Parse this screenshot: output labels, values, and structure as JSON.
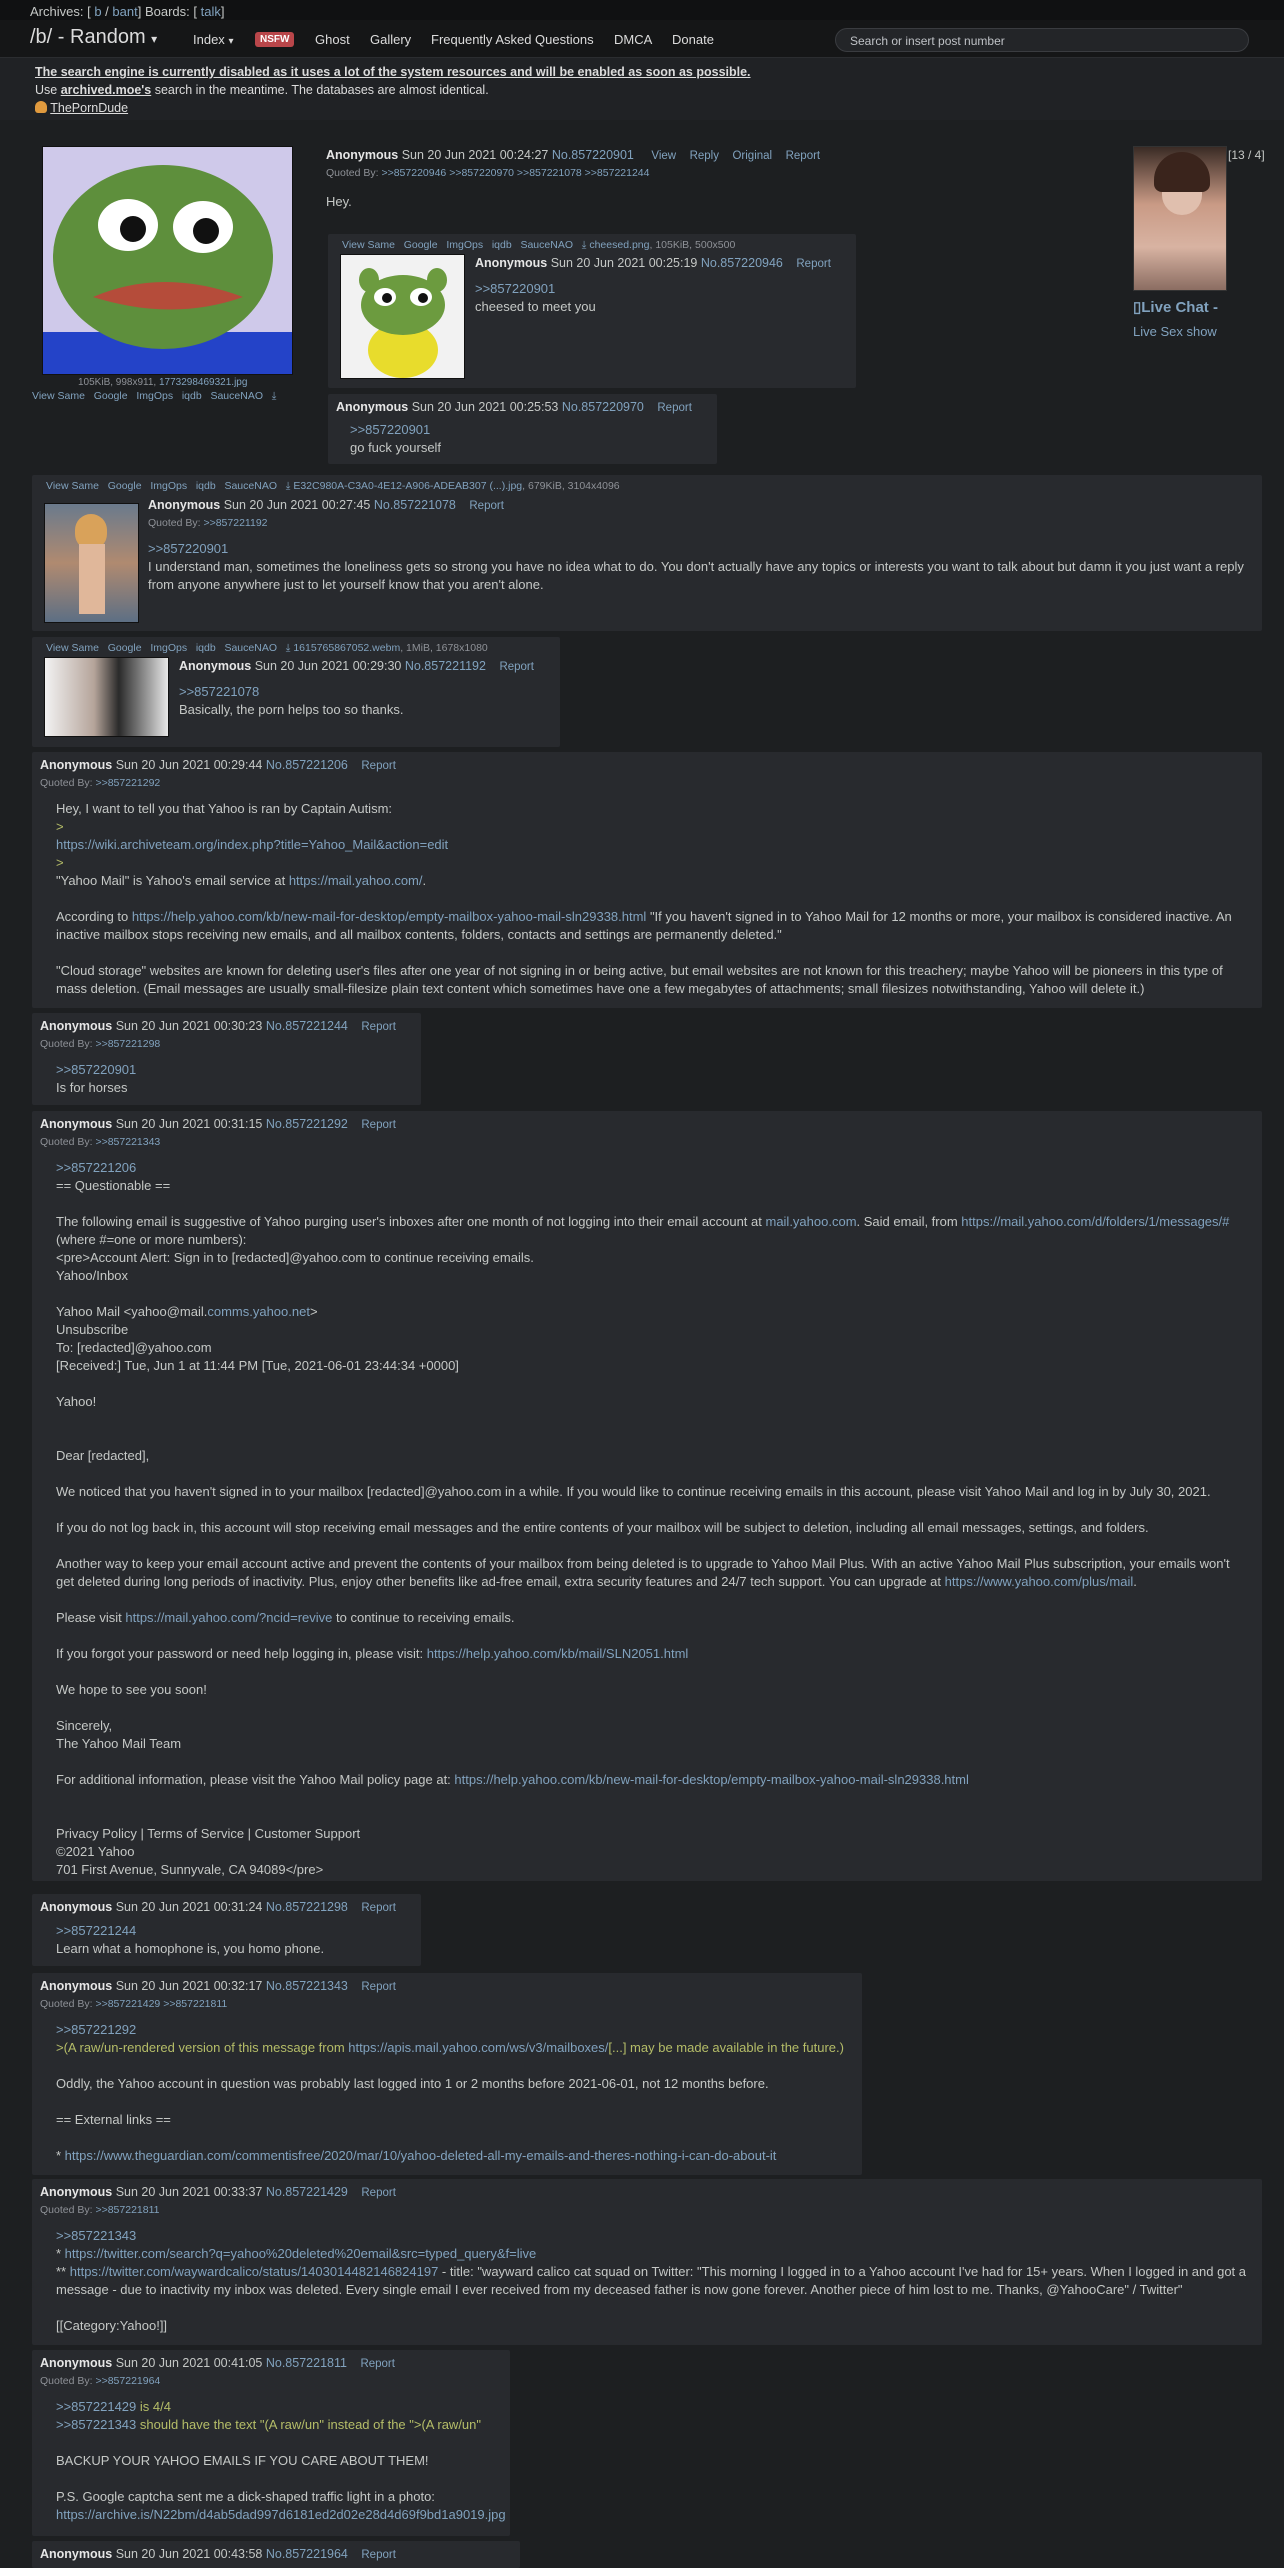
{
  "topbar": {
    "archives_label": "Archives: [",
    "archive_link_1": "b",
    "sep": "/",
    "archive_link_2": "bant",
    "boards_label": "] Boards: [",
    "board_link": "talk",
    "close": "]"
  },
  "nav": {
    "board_title": "/b/ - Random",
    "board_caret": "▾",
    "index_label": "Index",
    "index_caret": "▾",
    "nsfw_badge": "NSFW",
    "ghost": "Ghost",
    "gallery": "Gallery",
    "faq": "Frequently Asked Questions",
    "dmca": "DMCA",
    "donate": "Donate",
    "search_placeholder": "Search or insert post number"
  },
  "notice": {
    "line1": "The search engine is currently disabled as it uses a lot of the system resources and will be enabled as soon as possible.",
    "line2_pre": "Use ",
    "line2_link": "archived.moe's",
    "line2_post": " search in the meantime. The databases are almost identical.",
    "sponsor": "ThePornDude"
  },
  "ad": {
    "counter": "[13 / 4]",
    "title": "Live Chat -",
    "subtitle": "Live Sex show"
  },
  "op": {
    "file_info": "105KiB, 998x911, ",
    "file_name": "1773298469321.jpg",
    "tools": [
      "View Same",
      "Google",
      "ImgOps",
      "iqdb",
      "SauceNAO"
    ],
    "name": "Anonymous",
    "time": "Sun 20 Jun 2021 00:24:27",
    "num": "No.857220901",
    "ctl_view": "View",
    "ctl_reply": "Reply",
    "ctl_original": "Original",
    "ctl_report": "Report",
    "quoted_by_label": "Quoted By:",
    "quoted_by": ">>857220946 >>857220970 >>857221078 >>857221244",
    "text": "Hey."
  },
  "r1": {
    "tools": [
      "View Same",
      "Google",
      "ImgOps",
      "iqdb",
      "SauceNAO"
    ],
    "file_name": "cheesed.png",
    "file_info": ", 105KiB, 500x500",
    "name": "Anonymous",
    "time": "Sun 20 Jun 2021 00:25:19",
    "num": "No.857220946",
    "report": "Report",
    "quote": ">>857220901",
    "text": "cheesed to meet you"
  },
  "r2": {
    "name": "Anonymous",
    "time": "Sun 20 Jun 2021 00:25:53",
    "num": "No.857220970",
    "report": "Report",
    "quote": ">>857220901",
    "text": "go fuck yourself"
  },
  "r3": {
    "tools": [
      "View Same",
      "Google",
      "ImgOps",
      "iqdb",
      "SauceNAO"
    ],
    "file_name": "E32C980A-C3A0-4E12-A906-ADEAB307 (...).jpg",
    "file_info": ", 679KiB, 3104x4096",
    "name": "Anonymous",
    "time": "Sun 20 Jun 2021 00:27:45",
    "num": "No.857221078",
    "report": "Report",
    "quoted_by_label": "Quoted By:",
    "quoted_by": ">>857221192",
    "quote": ">>857220901",
    "text": "I understand man, sometimes the loneliness gets so strong you have no idea what to do. You don't actually have any topics or interests you want to talk about but damn it you just want a reply from anyone anywhere just to let yourself know that you aren't alone."
  },
  "r4": {
    "tools": [
      "View Same",
      "Google",
      "ImgOps",
      "iqdb",
      "SauceNAO"
    ],
    "file_name": "1615765867052.webm",
    "file_info": ", 1MiB, 1678x1080",
    "name": "Anonymous",
    "time": "Sun 20 Jun 2021 00:29:30",
    "num": "No.857221192",
    "report": "Report",
    "quote": ">>857221078",
    "text": "Basically, the porn helps too so thanks."
  },
  "r5": {
    "name": "Anonymous",
    "time": "Sun 20 Jun 2021 00:29:44",
    "num": "No.857221206",
    "report": "Report",
    "quoted_by_label": "Quoted By:",
    "quoted_by": ">>857221292",
    "l1": "Hey, I want to tell you that Yahoo is ran by Captain Autism:",
    "l2": ">",
    "l3": "https://wiki.archiveteam.org/index.php?title=Yahoo_Mail&action=edit",
    "l4": ">",
    "l5_pre": "\"Yahoo Mail\" is Yahoo's email service at ",
    "l5_link": "https://mail.yahoo.com/",
    "l5_post": ".",
    "l6_pre": "According to ",
    "l6_link": "https://help.yahoo.com/kb/new-mail-for-desktop/empty-mailbox-yahoo-mail-sln29338.html",
    "l6_post": " \"If you haven't signed in to Yahoo Mail for 12 months or more, your mailbox is considered inactive. An inactive mailbox stops receiving new emails, and all mailbox contents, folders, contacts and settings are permanently deleted.\"",
    "l7": "\"Cloud storage\" websites are known for deleting user's files after one year of not signing in or being active, but email websites are not known for this treachery; maybe Yahoo will be pioneers in this type of mass deletion. (Email messages are usually small-filesize plain text content which sometimes have one a few megabytes of attachments; small filesizes notwithstanding, Yahoo will delete it.)"
  },
  "r6": {
    "name": "Anonymous",
    "time": "Sun 20 Jun 2021 00:30:23",
    "num": "No.857221244",
    "report": "Report",
    "quoted_by_label": "Quoted By:",
    "quoted_by": ">>857221298",
    "quote": ">>857220901",
    "text": "Is for horses"
  },
  "r7": {
    "name": "Anonymous",
    "time": "Sun 20 Jun 2021 00:31:15",
    "num": "No.857221292",
    "report": "Report",
    "quoted_by_label": "Quoted By:",
    "quoted_by": ">>857221343",
    "quote": ">>857221206",
    "l1": "== Questionable ==",
    "l2_pre": "The following email is suggestive of Yahoo purging user's inboxes after one month of not logging into their email account at ",
    "l2_link1": "mail.yahoo.com",
    "l2_mid": ". Said email, from ",
    "l2_link2": "https://mail.yahoo.com/d/folders/1/messages/#",
    "l3": "(where #=one or more numbers):",
    "l4": "<pre>Account Alert: Sign in to [redacted]@yahoo.com to continue receiving emails.",
    "l5": "Yahoo/Inbox",
    "l6_pre": "Yahoo Mail <yahoo@mail.",
    "l6_link": "comms.yahoo.net",
    "l6_post": ">",
    "l7": "Unsubscribe",
    "l8": "To: [redacted]@yahoo.com",
    "l9": "[Received:] Tue, Jun 1 at 11:44 PM [Tue, 2021-06-01 23:44:34 +0000]",
    "l10": "Yahoo!",
    "l11": "Dear [redacted],",
    "l12": "We noticed that you haven't signed in to your mailbox [redacted]@yahoo.com in a while. If you would like to continue receiving emails in this account, please visit Yahoo Mail and log in by July 30, 2021.",
    "l13": "If you do not log back in, this account will stop receiving email messages and the entire contents of your mailbox will be subject to deletion, including all email messages, settings, and folders.",
    "l14_pre": "Another way to keep your email account active and prevent the contents of your mailbox from being deleted is to upgrade to Yahoo Mail Plus. With an active Yahoo Mail Plus subscription, your emails won't get deleted during long periods of inactivity. Plus, enjoy other benefits like ad-free email, extra security features and 24/7 tech support. You can upgrade at ",
    "l14_link": "https://www.yahoo.com/plus/mail",
    "l14_post": ".",
    "l15_pre": "Please visit ",
    "l15_link": "https://mail.yahoo.com/?ncid=revive",
    "l15_post": " to continue to receiving emails.",
    "l16_pre": "If you forgot your password or need help logging in, please visit: ",
    "l16_link": "https://help.yahoo.com/kb/mail/SLN2051.html",
    "l17": "We hope to see you soon!",
    "l18": "Sincerely,",
    "l19": "The Yahoo Mail Team",
    "l20_pre": "For additional information, please visit the Yahoo Mail policy page at: ",
    "l20_link": "https://help.yahoo.com/kb/new-mail-for-desktop/empty-mailbox-yahoo-mail-sln29338.html",
    "l21": "Privacy Policy | Terms of Service | Customer Support",
    "l22": "©2021 Yahoo",
    "l23": "701 First Avenue, Sunnyvale, CA 94089</pre>"
  },
  "r8": {
    "name": "Anonymous",
    "time": "Sun 20 Jun 2021 00:31:24",
    "num": "No.857221298",
    "report": "Report",
    "quote": ">>857221244",
    "text": "Learn what a homophone is, you homo phone."
  },
  "r9": {
    "name": "Anonymous",
    "time": "Sun 20 Jun 2021 00:32:17",
    "num": "No.857221343",
    "report": "Report",
    "quoted_by_label": "Quoted By:",
    "quoted_by": ">>857221429 >>857221811",
    "quote": ">>857221292",
    "l1_pre": ">(A raw/un-rendered version of this message from ",
    "l1_link": "https://apis.mail.yahoo.com/ws/v3/mailboxes/",
    "l1_post": "[...] may be made available in the future.)",
    "l2": "Oddly, the Yahoo account in question was probably last logged into 1 or 2 months before 2021-06-01, not 12 months before.",
    "l3": "== External links ==",
    "l4_pre": "* ",
    "l4_link": "https://www.theguardian.com/commentisfree/2020/mar/10/yahoo-deleted-all-my-emails-and-theres-nothing-i-can-do-about-it"
  },
  "r10": {
    "name": "Anonymous",
    "time": "Sun 20 Jun 2021 00:33:37",
    "num": "No.857221429",
    "report": "Report",
    "quoted_by_label": "Quoted By:",
    "quoted_by": ">>857221811",
    "quote": ">>857221343",
    "l1_pre": "* ",
    "l1_link": "https://twitter.com/search?q=yahoo%20deleted%20email&src=typed_query&f=live",
    "l2_pre": "** ",
    "l2_link": "https://twitter.com/waywardcalico/status/1403014482146824197",
    "l2_post": " - title: \"wayward calico cat squad on Twitter: \"This morning I logged in to a Yahoo account I've had for 15+ years. When I logged in and got a message - due to inactivity my inbox was deleted. Every single email I ever received from my deceased father is now gone forever. Another piece of him lost to me. Thanks, @YahooCare\" / Twitter\"",
    "l3": "[[Category:Yahoo!]]"
  },
  "r11": {
    "name": "Anonymous",
    "time": "Sun 20 Jun 2021 00:41:05",
    "num": "No.857221811",
    "report": "Report",
    "quoted_by_label": "Quoted By:",
    "quoted_by": ">>857221964",
    "l1_link": ">>857221429",
    "l1_post": " is 4/4",
    "l2_link": ">>857221343",
    "l2_post": " should have the text \"(A raw/un\" instead of the \">(A raw/un\"",
    "l3": "BACKUP YOUR YAHOO EMAILS IF YOU CARE ABOUT THEM!",
    "l4": "P.S. Google captcha sent me a dick-shaped traffic light in a photo:",
    "l5": "https://archive.is/N22bm/d4ab5dad997d6181ed2d02e28d4d69f9bd1a9019.jpg"
  },
  "r12": {
    "name": "Anonymous",
    "time": "Sun 20 Jun 2021 00:43:58",
    "num": "No.857221964",
    "report": "Report"
  }
}
